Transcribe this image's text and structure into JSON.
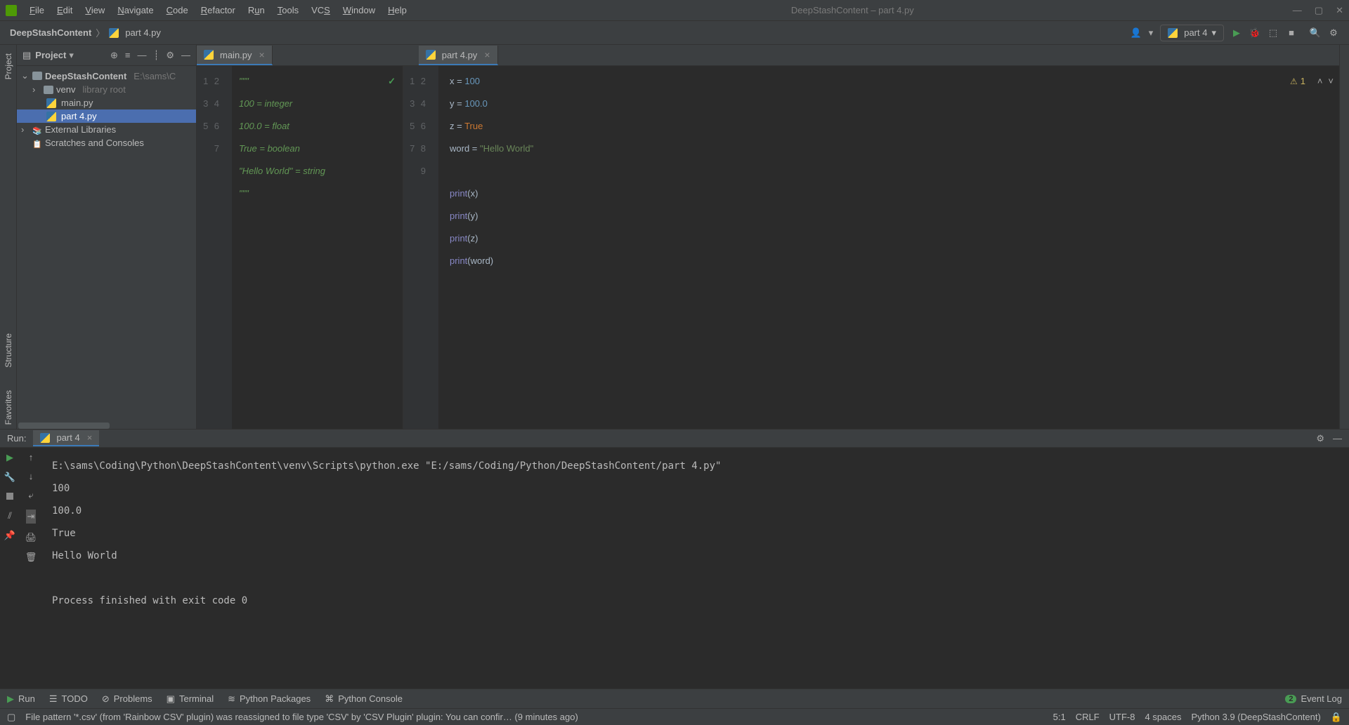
{
  "titlebar": {
    "title": "DeepStashContent – part 4.py",
    "menu": [
      "File",
      "Edit",
      "View",
      "Navigate",
      "Code",
      "Refactor",
      "Run",
      "Tools",
      "VCS",
      "Window",
      "Help"
    ]
  },
  "breadcrumb": {
    "project": "DeepStashContent",
    "file": "part 4.py"
  },
  "runConfig": {
    "name": "part 4"
  },
  "projectPanel": {
    "title": "Project",
    "root": {
      "name": "DeepStashContent",
      "path": "E:\\sams\\C"
    },
    "venv": {
      "name": "venv",
      "tag": "library root"
    },
    "files": [
      "main.py",
      "part 4.py"
    ],
    "extLib": "External Libraries",
    "scratches": "Scratches and Consoles"
  },
  "tabs": {
    "left": "main.py",
    "right": "part 4.py"
  },
  "editorLeft": {
    "gutter": [
      "1",
      "2",
      "3",
      "4",
      "5",
      "6",
      "7"
    ],
    "lines": [
      {
        "t": "comment",
        "v": "\"\"\""
      },
      {
        "t": "comment",
        "v": "100 = integer"
      },
      {
        "t": "comment",
        "v": "100.0 = float"
      },
      {
        "t": "comment",
        "v": "True = boolean"
      },
      {
        "t": "comment",
        "v": "\"Hello World\" = string"
      },
      {
        "t": "comment",
        "v": "\"\"\""
      },
      {
        "t": "plain",
        "v": ""
      }
    ]
  },
  "editorRight": {
    "gutter": [
      "1",
      "2",
      "3",
      "4",
      "5",
      "6",
      "7",
      "8",
      "9"
    ],
    "warnCount": "1",
    "code": {
      "l1a": "x ",
      "l1b": "= ",
      "l1c": "100",
      "l2a": "y ",
      "l2b": "= ",
      "l2c": "100.0",
      "l3a": "z ",
      "l3b": "= ",
      "l3c": "True",
      "l4a": "word ",
      "l4b": "= ",
      "l4c": "\"Hello World\"",
      "l6": "print",
      "l6b": "(x)",
      "l7": "print",
      "l7b": "(y)",
      "l8": "print",
      "l8b": "(z)",
      "l9": "print",
      "l9b": "(word)"
    }
  },
  "runPanel": {
    "label": "Run:",
    "tab": "part 4",
    "output": "E:\\sams\\Coding\\Python\\DeepStashContent\\venv\\Scripts\\python.exe \"E:/sams/Coding/Python/DeepStashContent/part 4.py\"\n100\n100.0\nTrue\nHello World\n\nProcess finished with exit code 0"
  },
  "bottomTools": {
    "run": "Run",
    "todo": "TODO",
    "problems": "Problems",
    "terminal": "Terminal",
    "pypkg": "Python Packages",
    "pyconsole": "Python Console",
    "eventLog": "Event Log",
    "eventCount": "2"
  },
  "leftRail": {
    "project": "Project",
    "structure": "Structure",
    "favorites": "Favorites"
  },
  "statusbar": {
    "msg": "File pattern '*.csv' (from 'Rainbow CSV' plugin) was reassigned to file type 'CSV' by 'CSV Plugin' plugin: You can confir… (9 minutes ago)",
    "pos": "5:1",
    "crlf": "CRLF",
    "enc": "UTF-8",
    "indent": "4 spaces",
    "interp": "Python 3.9 (DeepStashContent)"
  }
}
